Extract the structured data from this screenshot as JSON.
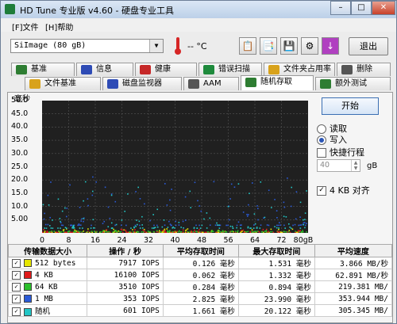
{
  "window": {
    "title": "HD Tune 专业版 v4.60 - 硬盘专业工具"
  },
  "menu": [
    {
      "label": "[F]文件"
    },
    {
      "label": "[H]帮助"
    }
  ],
  "toolbar": {
    "drive": "SiImage   (80 gB)",
    "temperature": "-- °C",
    "exit_label": "退出"
  },
  "tabs_row1": [
    {
      "label": "基准",
      "color": "#2e7d32"
    },
    {
      "label": "信息",
      "color": "#2e4bb5"
    },
    {
      "label": "健康",
      "color": "#c62828"
    },
    {
      "label": "错误扫描",
      "color": "#1e8a3c"
    },
    {
      "label": "文件夹占用率",
      "color": "#d8a21b"
    },
    {
      "label": "删除",
      "color": "#555555"
    }
  ],
  "tabs_row2": [
    {
      "label": "文件基准",
      "color": "#d8a21b"
    },
    {
      "label": "磁盘监视器",
      "color": "#2e4bb5"
    },
    {
      "label": "AAM",
      "color": "#555555"
    },
    {
      "label": "随机存取",
      "color": "#2e7d32"
    },
    {
      "label": "额外测试",
      "color": "#2e7d32"
    }
  ],
  "chart_data": {
    "type": "scatter",
    "title": "",
    "ylabel": "毫秒",
    "xlabel": "gB",
    "ylim": [
      0,
      50
    ],
    "xlim": [
      0,
      80
    ],
    "y_ticks": [
      "50.0",
      "45.0",
      "40.0",
      "35.0",
      "30.0",
      "25.0",
      "20.0",
      "15.0",
      "10.0",
      "5.00"
    ],
    "x_ticks": [
      "0",
      "8",
      "16",
      "24",
      "32",
      "40",
      "48",
      "56",
      "64",
      "72",
      "80gB"
    ],
    "grid": true,
    "series": [
      {
        "name": "512 bytes",
        "color": "#e6e600",
        "y_range": [
          0.1,
          1.5
        ]
      },
      {
        "name": "4 KB",
        "color": "#e01b1b",
        "y_range": [
          0.1,
          1.3
        ]
      },
      {
        "name": "64 KB",
        "color": "#2bbf2b",
        "y_range": [
          0.3,
          0.9
        ]
      },
      {
        "name": "1 MB",
        "color": "#2b5bd8",
        "y_range": [
          2.8,
          24.0
        ]
      },
      {
        "name": "随机",
        "color": "#22c6c6",
        "y_range": [
          1.7,
          20.1
        ]
      }
    ]
  },
  "controls": {
    "start_label": "开始",
    "read_label": "读取",
    "write_label": "写入",
    "short_stroke_label": "快捷行程",
    "short_stroke_value": "40",
    "short_stroke_unit": "gB",
    "align_label": "4 KB 对齐"
  },
  "results": {
    "headers": [
      "传输数据大小",
      "操作 / 秒",
      "平均存取时间",
      "最大存取时间",
      "平均速度"
    ],
    "rows": [
      {
        "name": "512 bytes",
        "color": "#e6e600",
        "iops": "7917 IOPS",
        "avg": "0.126 毫秒",
        "max": "1.531 毫秒",
        "speed": "3.866 MB/秒"
      },
      {
        "name": "4 KB",
        "color": "#e01b1b",
        "iops": "16100 IOPS",
        "avg": "0.062 毫秒",
        "max": "1.332 毫秒",
        "speed": "62.891 MB/秒"
      },
      {
        "name": "64 KB",
        "color": "#2bbf2b",
        "iops": "3510 IOPS",
        "avg": "0.284 毫秒",
        "max": "0.894 毫秒",
        "speed": "219.381 MB/"
      },
      {
        "name": "1 MB",
        "color": "#2b5bd8",
        "iops": "353 IOPS",
        "avg": "2.825 毫秒",
        "max": "23.990 毫秒",
        "speed": "353.944 MB/"
      },
      {
        "name": "随机",
        "color": "#22c6c6",
        "iops": "601 IOPS",
        "avg": "1.661 毫秒",
        "max": "20.122 毫秒",
        "speed": "305.345 MB/"
      }
    ]
  }
}
